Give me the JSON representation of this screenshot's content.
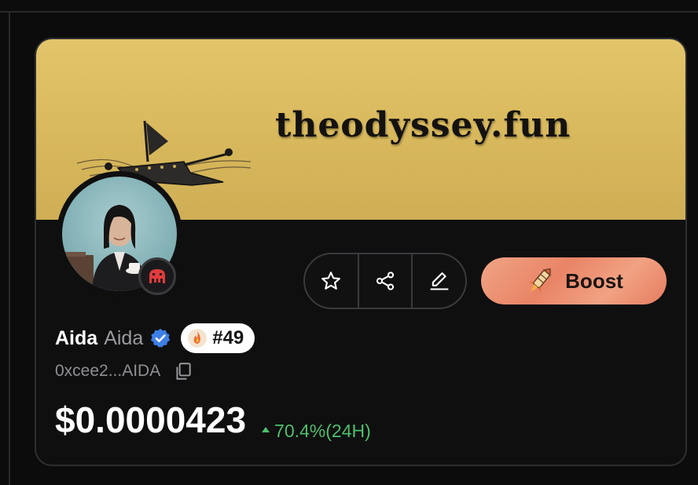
{
  "banner": {
    "title": "theodyssey.fun"
  },
  "profile": {
    "name": "Aida",
    "handle": "Aida",
    "rank": "#49",
    "address": "0xcee2...AIDA"
  },
  "actions": {
    "boost_label": "Boost"
  },
  "price": {
    "value": "$0.0000423",
    "change": "70.4%(24H)"
  },
  "colors": {
    "accent_gold": "#e2c56a",
    "boost": "#e98466",
    "positive": "#4fbf6b",
    "verified": "#3d7fe6"
  },
  "icons": [
    "star-icon",
    "share-icon",
    "edit-icon",
    "rocket-icon",
    "verified-icon",
    "fire-icon",
    "copy-icon",
    "alien-icon"
  ]
}
